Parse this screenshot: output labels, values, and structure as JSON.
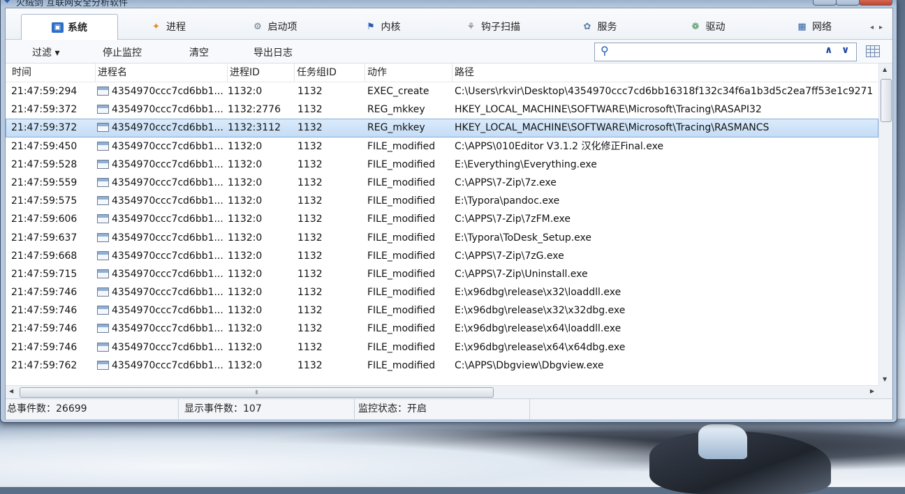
{
  "window": {
    "title": "火绒剑 互联网安全分析软件"
  },
  "tabs": [
    {
      "label": "系统",
      "icon": "system-monitor-icon",
      "active": true
    },
    {
      "label": "进程",
      "icon": "process-icon"
    },
    {
      "label": "启动项",
      "icon": "startup-gear-icon"
    },
    {
      "label": "内核",
      "icon": "kernel-icon"
    },
    {
      "label": "钩子扫描",
      "icon": "hook-scan-icon"
    },
    {
      "label": "服务",
      "icon": "service-icon"
    },
    {
      "label": "驱动",
      "icon": "driver-icon"
    },
    {
      "label": "网络",
      "icon": "network-icon"
    }
  ],
  "toolbar": {
    "filter_label": "过滤 ▾",
    "stop_label": "停止监控",
    "clear_label": "清空",
    "export_label": "导出日志",
    "search_placeholder": ""
  },
  "table": {
    "columns": [
      "时间",
      "进程名",
      "进程ID",
      "任务组ID",
      "动作",
      "路径"
    ],
    "rows": [
      {
        "time": "21:47:59:294",
        "proc": "4354970ccc7cd6bb1...",
        "pid": "1132:0",
        "tgid": "1132",
        "action": "EXEC_create",
        "path": "C:\\Users\\rkvir\\Desktop\\4354970ccc7cd6bb16318f132c34f6a1b3d5c2ea7ff53e1c9271"
      },
      {
        "time": "21:47:59:372",
        "proc": "4354970ccc7cd6bb1...",
        "pid": "1132:2776",
        "tgid": "1132",
        "action": "REG_mkkey",
        "path": "HKEY_LOCAL_MACHINE\\SOFTWARE\\Microsoft\\Tracing\\RASAPI32"
      },
      {
        "time": "21:47:59:372",
        "proc": "4354970ccc7cd6bb1...",
        "pid": "1132:3112",
        "tgid": "1132",
        "action": "REG_mkkey",
        "path": "HKEY_LOCAL_MACHINE\\SOFTWARE\\Microsoft\\Tracing\\RASMANCS",
        "selected": true
      },
      {
        "time": "21:47:59:450",
        "proc": "4354970ccc7cd6bb1...",
        "pid": "1132:0",
        "tgid": "1132",
        "action": "FILE_modified",
        "path": "C:\\APPS\\010Editor V3.1.2 汉化修正Final.exe"
      },
      {
        "time": "21:47:59:528",
        "proc": "4354970ccc7cd6bb1...",
        "pid": "1132:0",
        "tgid": "1132",
        "action": "FILE_modified",
        "path": "E:\\Everything\\Everything.exe"
      },
      {
        "time": "21:47:59:559",
        "proc": "4354970ccc7cd6bb1...",
        "pid": "1132:0",
        "tgid": "1132",
        "action": "FILE_modified",
        "path": "C:\\APPS\\7-Zip\\7z.exe"
      },
      {
        "time": "21:47:59:575",
        "proc": "4354970ccc7cd6bb1...",
        "pid": "1132:0",
        "tgid": "1132",
        "action": "FILE_modified",
        "path": "E:\\Typora\\pandoc.exe"
      },
      {
        "time": "21:47:59:606",
        "proc": "4354970ccc7cd6bb1...",
        "pid": "1132:0",
        "tgid": "1132",
        "action": "FILE_modified",
        "path": "C:\\APPS\\7-Zip\\7zFM.exe"
      },
      {
        "time": "21:47:59:637",
        "proc": "4354970ccc7cd6bb1...",
        "pid": "1132:0",
        "tgid": "1132",
        "action": "FILE_modified",
        "path": "E:\\Typora\\ToDesk_Setup.exe"
      },
      {
        "time": "21:47:59:668",
        "proc": "4354970ccc7cd6bb1...",
        "pid": "1132:0",
        "tgid": "1132",
        "action": "FILE_modified",
        "path": "C:\\APPS\\7-Zip\\7zG.exe"
      },
      {
        "time": "21:47:59:715",
        "proc": "4354970ccc7cd6bb1...",
        "pid": "1132:0",
        "tgid": "1132",
        "action": "FILE_modified",
        "path": "C:\\APPS\\7-Zip\\Uninstall.exe"
      },
      {
        "time": "21:47:59:746",
        "proc": "4354970ccc7cd6bb1...",
        "pid": "1132:0",
        "tgid": "1132",
        "action": "FILE_modified",
        "path": "E:\\x96dbg\\release\\x32\\loaddll.exe"
      },
      {
        "time": "21:47:59:746",
        "proc": "4354970ccc7cd6bb1...",
        "pid": "1132:0",
        "tgid": "1132",
        "action": "FILE_modified",
        "path": "E:\\x96dbg\\release\\x32\\x32dbg.exe"
      },
      {
        "time": "21:47:59:746",
        "proc": "4354970ccc7cd6bb1...",
        "pid": "1132:0",
        "tgid": "1132",
        "action": "FILE_modified",
        "path": "E:\\x96dbg\\release\\x64\\loaddll.exe"
      },
      {
        "time": "21:47:59:746",
        "proc": "4354970ccc7cd6bb1...",
        "pid": "1132:0",
        "tgid": "1132",
        "action": "FILE_modified",
        "path": "E:\\x96dbg\\release\\x64\\x64dbg.exe"
      },
      {
        "time": "21:47:59:762",
        "proc": "4354970ccc7cd6bb1...",
        "pid": "1132:0",
        "tgid": "1132",
        "action": "FILE_modified",
        "path": "C:\\APPS\\Dbgview\\Dbgview.exe"
      }
    ]
  },
  "status": {
    "total": "总事件数：26699",
    "shown": "显示事件数：107",
    "monitor": "监控状态：开启"
  },
  "colors": {
    "selection": "#c3dcf5",
    "accent": "#1a43a0"
  }
}
